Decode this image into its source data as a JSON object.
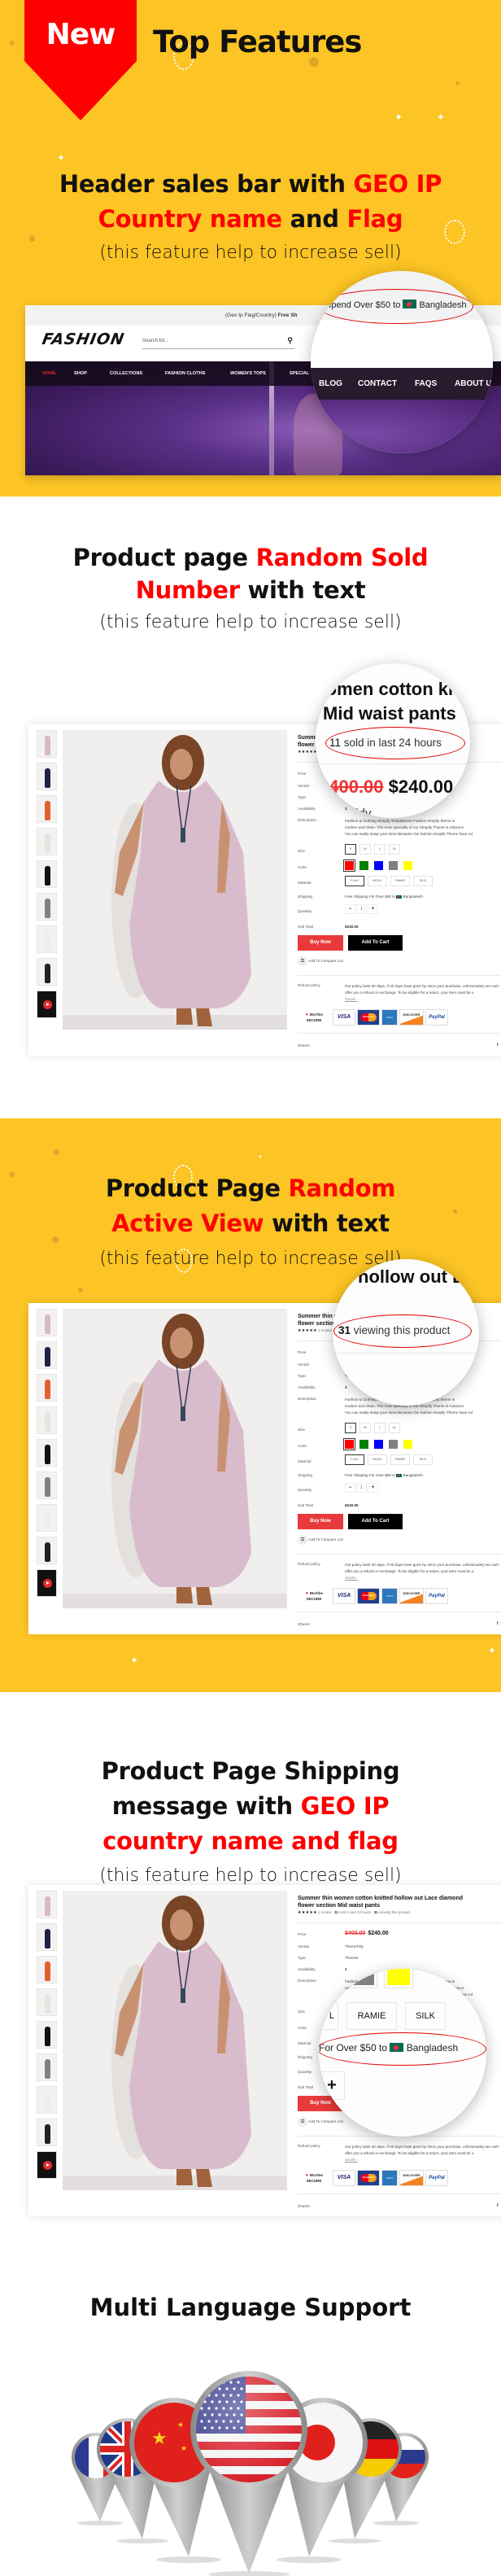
{
  "colors": {
    "background_yellow": "#fcc424",
    "highlight_red": "#ff0000",
    "buy_now": "#e83a3a",
    "add_to_cart": "#000000"
  },
  "header": {
    "badge": "New",
    "title": "Top Features"
  },
  "feature_header_bar": {
    "line1_a": "Header sales bar with ",
    "line1_b": "GEO IP",
    "line2_a": "Country name",
    "line2_b": " and ",
    "line2_c": "Flag",
    "subtitle": "(this feature help to increase sell)",
    "site": {
      "topbar_text": "(Geo Ip Flag/Country) ",
      "topbar_bold": "Free Sh",
      "logo": "FASHION",
      "search_placeholder": "Search for...",
      "search_icon": "magnifier-icon",
      "nav": [
        "HOME",
        "SHOP",
        "COLLECTIONS",
        "FASHION CLOTHS",
        "WOMEN'S TOPS",
        "SPECIAL"
      ],
      "magnified_nav": [
        "BLOG",
        "CONTACT",
        "FAQS",
        "ABOUT U"
      ],
      "magnified_bar_text": "Spend Over $50 to",
      "country": "Bangladesh"
    }
  },
  "feature_sold": {
    "line1_a": "Product page ",
    "line1_b": "Random Sold",
    "line2_a": "Number",
    "line2_b": " with text",
    "subtitle": "(this feature help to increase sell)",
    "magnified_count": "11",
    "magnified_text": " sold in last 24 hours"
  },
  "feature_views": {
    "line1_a": "Product Page ",
    "line1_b": "Random",
    "line2_a": "Active View",
    "line2_b": " with text",
    "subtitle": "(this feature help to increase sell)",
    "magnified_count": "31",
    "magnified_text": " viewing this product"
  },
  "feature_shipping": {
    "line1": "Product Page Shipping",
    "line2_a": "message with ",
    "line2_b": "GEO IP",
    "line3": "country name and flag",
    "subtitle": "(this feature help to increase sell)",
    "magnified_text": "For Over $50 to",
    "country": "Bangladesh",
    "magnified_options": [
      "L",
      "RAMIE",
      "SILK"
    ],
    "magnified_plus": "+"
  },
  "multi_language": {
    "title": "Multi Language Support",
    "flags": [
      "france-flag-icon",
      "uk-flag-icon",
      "china-flag-icon",
      "usa-flag-icon",
      "japan-flag-icon",
      "germany-flag-icon",
      "russia-flag-icon"
    ]
  },
  "product": {
    "title_line1": "Summer thin women cotton knitted hollow out Lace diamond",
    "title_line2": "flower section Mid waist pants",
    "stars": "★★★★★",
    "rating": 5,
    "reviews": "1 review",
    "sold_count": "11",
    "sold_text": " sold in last 24 hours",
    "viewing_count": "31",
    "viewing_text": " viewing this product",
    "labels": {
      "price": "Price",
      "vendor": "Vendor",
      "type": "Type",
      "availability": "Availability",
      "description": "Description",
      "size": "Size",
      "color": "Color",
      "material": "Material",
      "shipping": "Shipping",
      "quantity": "Quantity",
      "subtotal": "Sub Total",
      "refund": "Refund policy",
      "shares": "Shares:"
    },
    "old_price": "$400.00",
    "price": "$240.00",
    "vendor": "ThemeTidy",
    "type": "Themes",
    "availability": "1",
    "description": [
      "Fashion & Clothing Shopify TemplateOur Fashion shopify theme is",
      "modern and clean. The main specialty of our Shopify Theme is Advance",
      "You can easily setup your store Because Our fashion shopify Theme have Ad"
    ],
    "sizes": [
      "S",
      "M",
      "L",
      "XL"
    ],
    "selected_size": "S",
    "colors": [
      "#ff0000",
      "#008000",
      "#0000ff",
      "#808080",
      "#ffff00"
    ],
    "selected_color": "#ff0000",
    "materials": [
      "FLAX",
      "WOOL",
      "RAMIE",
      "SILK"
    ],
    "selected_material": "FLAX",
    "shipping_text": "Free Shipping For Over $50 to",
    "shipping_country": "Bangladesh",
    "quantity": "1",
    "qty_minus": "−",
    "qty_plus": "+",
    "subtotal": "$240.00",
    "buy_now": "Buy Now",
    "add_to_cart": "Add To Cart",
    "compare": "Add To Compare List",
    "refund": [
      "Our policy lasts 30 days. If 30 days have gone by since your purchase, unfortunately we can't",
      "offer you a refund or exchange. To be eligible for a return, your item must be u"
    ],
    "details_link": "details ›",
    "payments": {
      "mcafee": "McAfee SECURE",
      "visa": "VISA",
      "mastercard": "MasterCard",
      "amex": "AMEX",
      "discover": "DISCOVER",
      "paypal": "PayPal"
    },
    "share_icons": [
      "f",
      "t",
      "in"
    ]
  }
}
